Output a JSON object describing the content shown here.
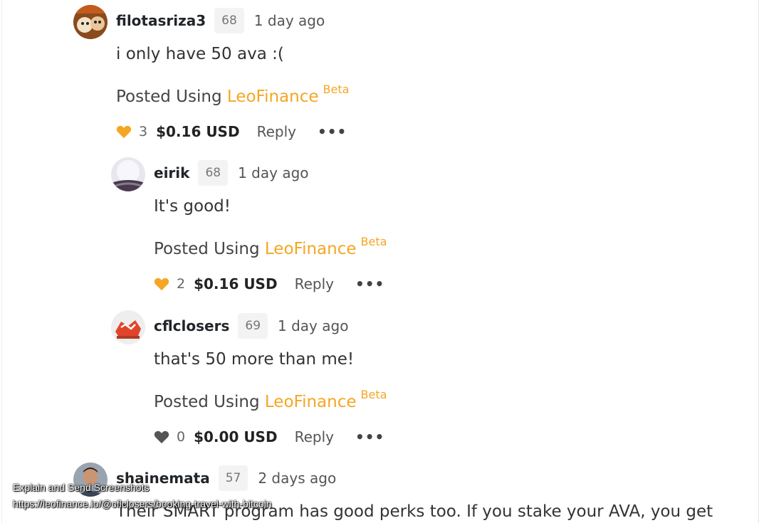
{
  "colors": {
    "brand": "#f5a623",
    "heart_voted": "#f5a623",
    "heart_unvoted": "#555555"
  },
  "comments": [
    {
      "author": "filotasriza3",
      "reputation": "68",
      "time": "1 day ago",
      "body": "i only have 50 ava :(",
      "posted_prefix": "Posted Using",
      "posted_brand": "LeoFinance",
      "posted_suffix": "Beta",
      "votes": "3",
      "payout": "$0.16 USD",
      "reply": "Reply",
      "more": "•••",
      "voted": true
    },
    {
      "author": "eirik",
      "reputation": "68",
      "time": "1 day ago",
      "body": "It's good!",
      "posted_prefix": "Posted Using",
      "posted_brand": "LeoFinance",
      "posted_suffix": "Beta",
      "votes": "2",
      "payout": "$0.16 USD",
      "reply": "Reply",
      "more": "•••",
      "voted": true
    },
    {
      "author": "cflclosers",
      "reputation": "69",
      "time": "1 day ago",
      "body": "that's 50 more than me!",
      "posted_prefix": "Posted Using",
      "posted_brand": "LeoFinance",
      "posted_suffix": "Beta",
      "votes": "0",
      "payout": "$0.00 USD",
      "reply": "Reply",
      "more": "•••",
      "voted": false
    },
    {
      "author": "shainemata",
      "reputation": "57",
      "time": "2 days ago",
      "body": "Their SMART program has good perks too. If you stake your AVA, you get"
    }
  ],
  "overlay": {
    "line1": "Explain and Send Screenshots",
    "line2": "https://leofinance.io/@cflclosers/booking-travel-with-bitcoin"
  }
}
